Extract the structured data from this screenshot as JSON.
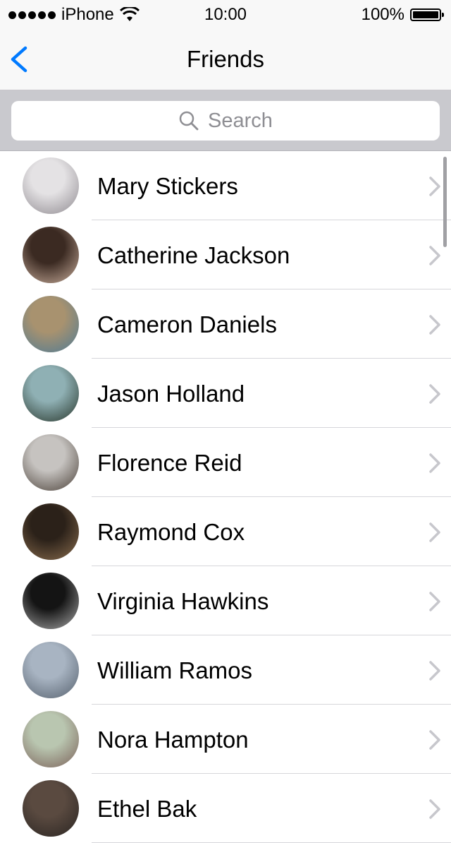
{
  "status_bar": {
    "carrier": "iPhone",
    "time": "10:00",
    "battery": "100%"
  },
  "nav": {
    "title": "Friends",
    "back_icon": "chevron-left-icon"
  },
  "search": {
    "placeholder": "Search",
    "icon": "search-icon"
  },
  "friends": [
    {
      "name": "Mary Stickers",
      "avatar_colors": [
        "#e4e2e4",
        "#8f8a90"
      ]
    },
    {
      "name": "Catherine Jackson",
      "avatar_colors": [
        "#3b2a22",
        "#c9ae9c"
      ]
    },
    {
      "name": "Cameron Daniels",
      "avatar_colors": [
        "#a8926f",
        "#4e7b95"
      ]
    },
    {
      "name": "Jason Holland",
      "avatar_colors": [
        "#8fb0b4",
        "#263429"
      ]
    },
    {
      "name": "Florence Reid",
      "avatar_colors": [
        "#c6c3c0",
        "#4a4038"
      ]
    },
    {
      "name": "Raymond Cox",
      "avatar_colors": [
        "#2b2119",
        "#8a6d4e"
      ]
    },
    {
      "name": "Virginia Hawkins",
      "avatar_colors": [
        "#141414",
        "#a8a8a8"
      ]
    },
    {
      "name": "William Ramos",
      "avatar_colors": [
        "#a8b4c2",
        "#55606d"
      ]
    },
    {
      "name": "Nora Hampton",
      "avatar_colors": [
        "#b9c6b0",
        "#7a6058"
      ]
    },
    {
      "name": "Ethel Bak",
      "avatar_colors": [
        "#5a4a40",
        "#2a2522"
      ]
    }
  ],
  "colors": {
    "accent": "#007aff",
    "chevron": "#c7c7cc",
    "separator": "#d6d6da"
  }
}
